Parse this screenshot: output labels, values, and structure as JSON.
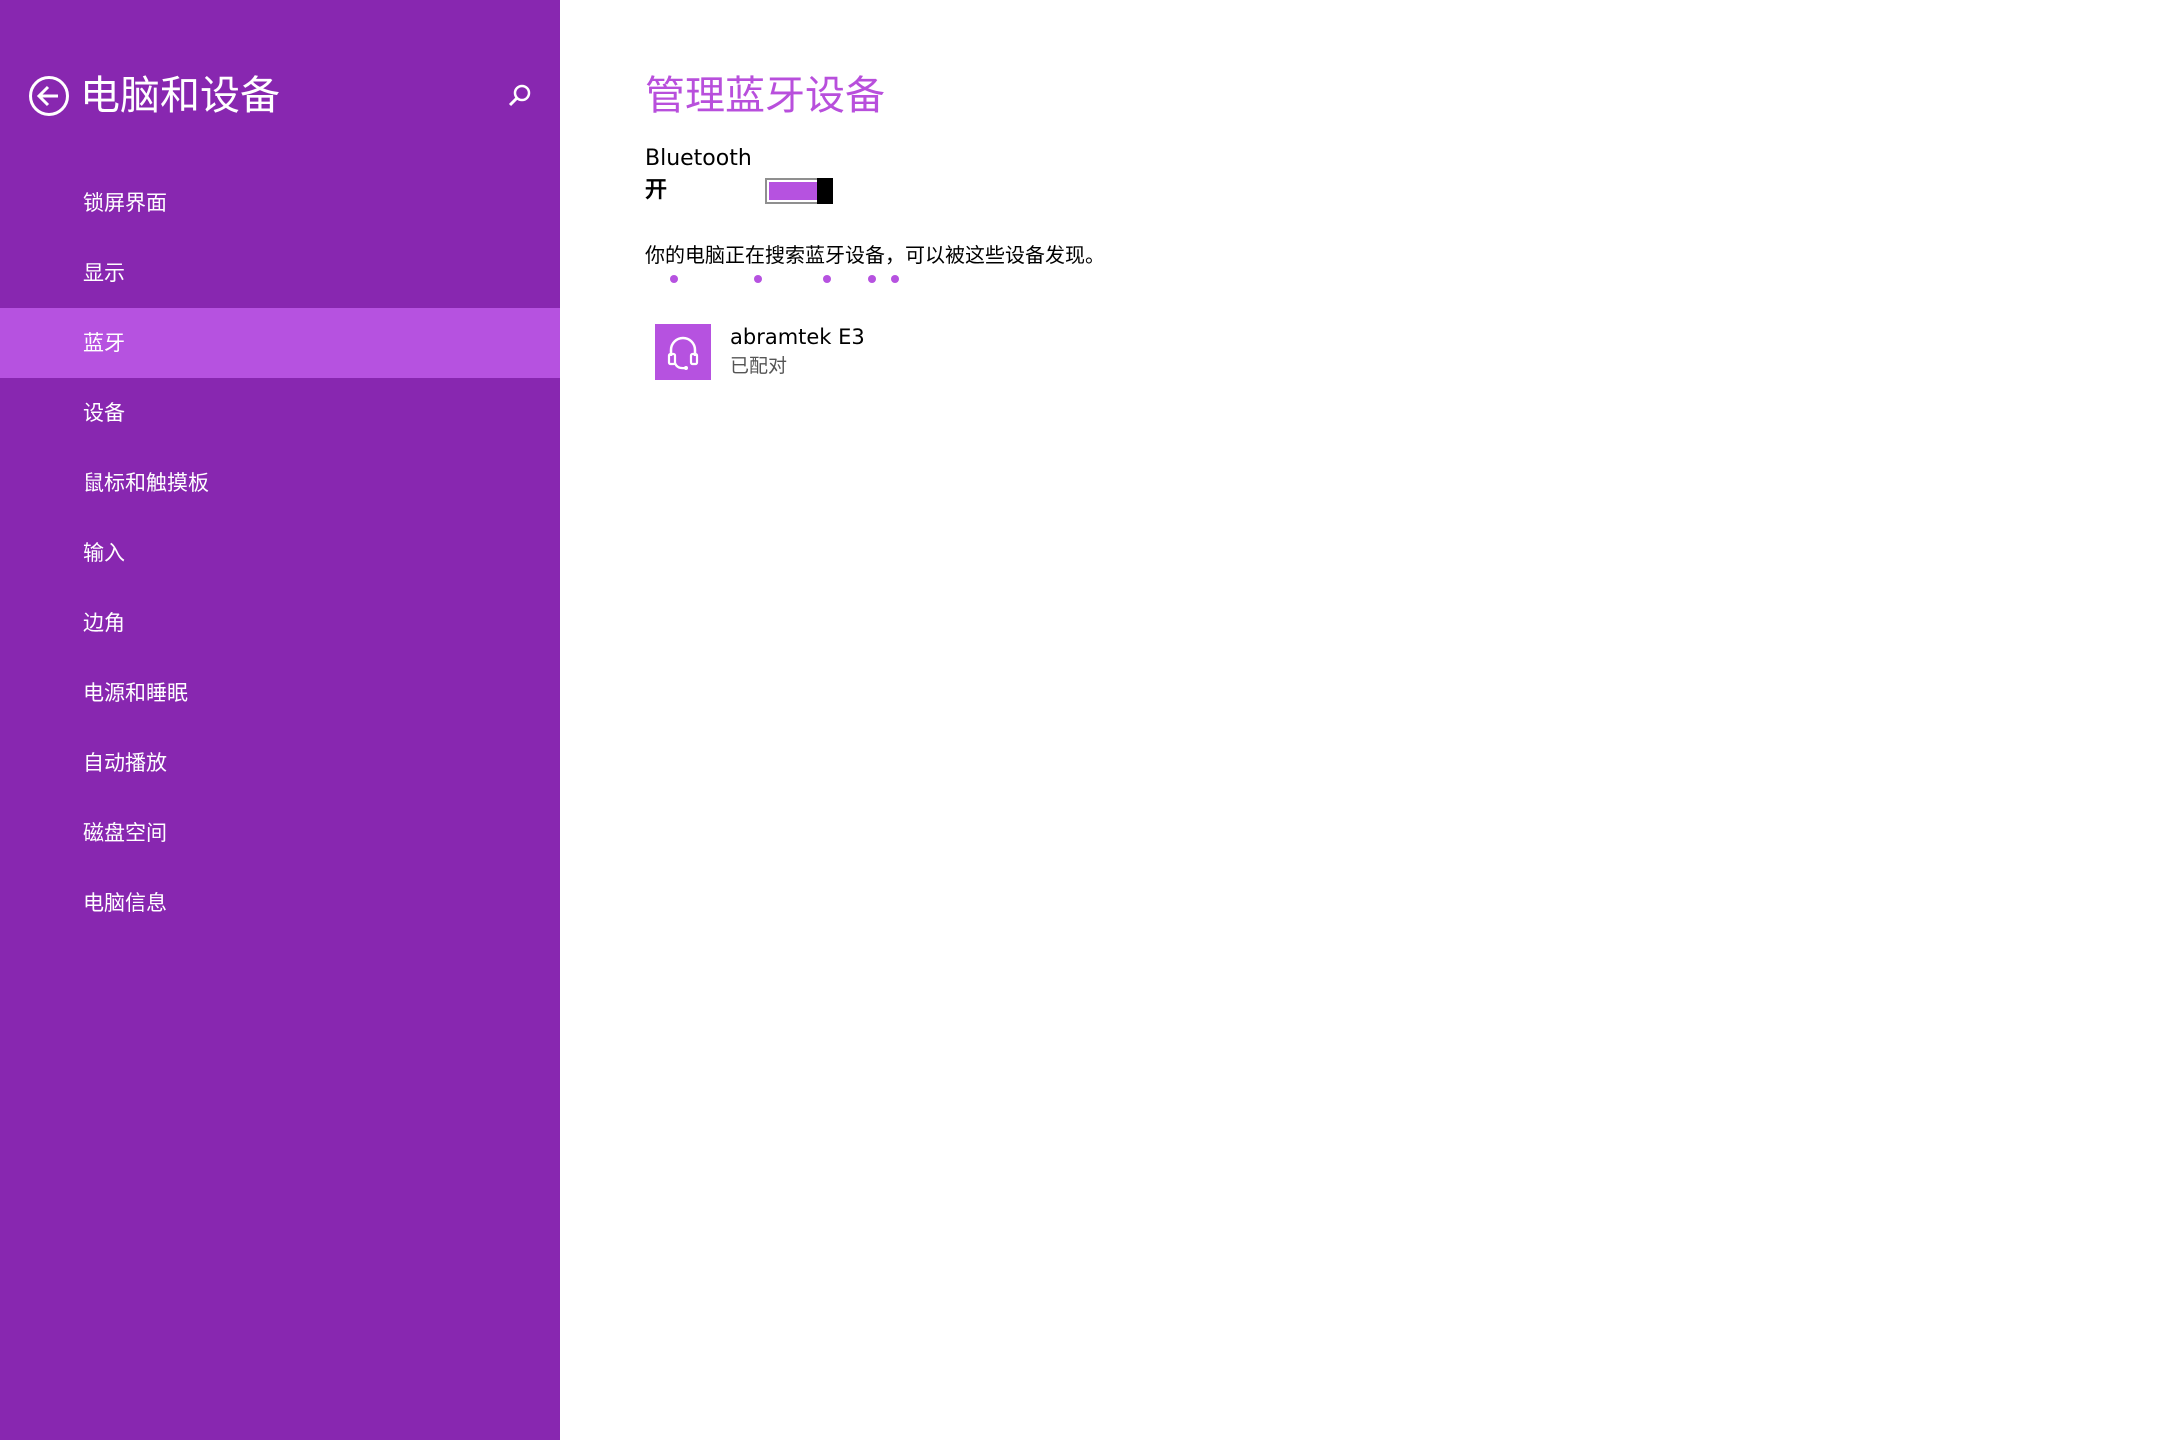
{
  "sidebar": {
    "title": "电脑和设备",
    "back_icon": "back-arrow-icon",
    "search_icon": "search-icon",
    "items": [
      {
        "label": "锁屏界面"
      },
      {
        "label": "显示"
      },
      {
        "label": "蓝牙",
        "selected": true
      },
      {
        "label": "设备"
      },
      {
        "label": "鼠标和触摸板"
      },
      {
        "label": "输入"
      },
      {
        "label": "边角"
      },
      {
        "label": "电源和睡眠"
      },
      {
        "label": "自动播放"
      },
      {
        "label": "磁盘空间"
      },
      {
        "label": "电脑信息"
      }
    ]
  },
  "main": {
    "title": "管理蓝牙设备",
    "bluetooth": {
      "label": "Bluetooth",
      "state_label": "开",
      "enabled": true
    },
    "status_text": "你的电脑正在搜索蓝牙设备，可以被这些设备发现。",
    "devices": [
      {
        "name": "abramtek E3",
        "status": "已配对",
        "icon": "headset-icon"
      }
    ]
  },
  "colors": {
    "sidebar_bg": "#8827b0",
    "selected_bg": "#b652e0",
    "accent": "#b84fdc",
    "content_bg": "#ffffff"
  }
}
